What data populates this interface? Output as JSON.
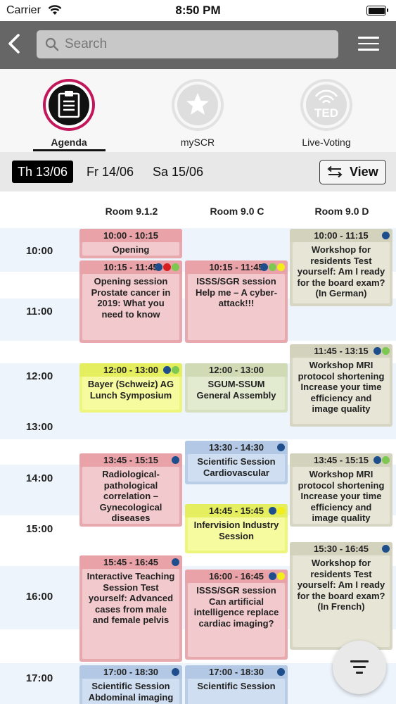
{
  "status_bar": {
    "carrier": "Carrier",
    "time": "8:50 PM"
  },
  "nav": {
    "search_placeholder": "Search"
  },
  "tabs": [
    {
      "label": "Agenda",
      "icon": "clipboard-icon",
      "active": true
    },
    {
      "label": "mySCR",
      "icon": "star-icon",
      "active": false
    },
    {
      "label": "Live-Voting",
      "icon": "ted-icon",
      "active": false
    }
  ],
  "dates": [
    {
      "label": "Th 13/06",
      "active": true
    },
    {
      "label": "Fr 14/06",
      "active": false
    },
    {
      "label": "Sa 15/06",
      "active": false
    }
  ],
  "view_button": {
    "label": "View"
  },
  "rooms": [
    "Room 9.1.2",
    "Room 9.0 C",
    "Room 9.0 D"
  ],
  "times": [
    "10:00",
    "11:00",
    "12:00",
    "13:00",
    "14:00",
    "15:00",
    "16:00",
    "17:00"
  ],
  "dot_colors": {
    "blue": "#1f4e8c",
    "red": "#d81e1e",
    "green": "#7ec852",
    "yellow": "#f3ee1a"
  },
  "events": [
    {
      "room": "Room 9.1.2",
      "time": "10:00 - 10:15",
      "title": "Opening",
      "color": "red",
      "dots": []
    },
    {
      "room": "Room 9.1.2",
      "time": "10:15 - 11:45",
      "title": "Opening session Prostate cancer in 2019: What you need to know",
      "color": "red",
      "dots": [
        "blue",
        "red",
        "green"
      ]
    },
    {
      "room": "Room 9.1.2",
      "time": "12:00 - 13:00",
      "title": "Bayer (Schweiz) AG Lunch Symposium",
      "color": "yellow",
      "dots": [
        "blue",
        "green"
      ]
    },
    {
      "room": "Room 9.1.2",
      "time": "13:45 - 15:15",
      "title": "Radiological-pathological correlation – Gynecological diseases",
      "color": "red",
      "dots": [
        "blue"
      ]
    },
    {
      "room": "Room 9.1.2",
      "time": "15:45 - 16:45",
      "title": "Interactive Teaching Session Test yourself: Advanced cases from male and female pelvis",
      "color": "red",
      "dots": [
        "blue"
      ]
    },
    {
      "room": "Room 9.1.2",
      "time": "17:00 - 18:30",
      "title": "Scientific Session Abdominal imaging",
      "color": "blue",
      "dots": [
        "blue"
      ]
    },
    {
      "room": "Room 9.0 C",
      "time": "10:15 - 11:45",
      "title": "ISSS/SGR session Help me – A cyber-attack!!!",
      "color": "red",
      "dots": [
        "blue",
        "green",
        "yellow"
      ]
    },
    {
      "room": "Room 9.0 C",
      "time": "12:00 - 13:00",
      "title": "SGUM-SSUM General Assembly",
      "color": "green",
      "dots": []
    },
    {
      "room": "Room 9.0 C",
      "time": "13:30 - 14:30",
      "title": "Scientific Session Cardiovascular",
      "color": "blue",
      "dots": [
        "blue"
      ]
    },
    {
      "room": "Room 9.0 C",
      "time": "14:45 - 15:45",
      "title": "Infervision Industry Session",
      "color": "yellow",
      "dots": [
        "blue",
        "yellow"
      ]
    },
    {
      "room": "Room 9.0 C",
      "time": "16:00 - 16:45",
      "title": "ISSS/SGR session Can artificial intelligence replace cardiac imaging?",
      "color": "red",
      "dots": [
        "blue",
        "yellow"
      ]
    },
    {
      "room": "Room 9.0 C",
      "time": "17:00 - 18:30",
      "title": "Scientific Session",
      "color": "blue",
      "dots": [
        "blue"
      ]
    },
    {
      "room": "Room 9.0 D",
      "time": "10:00 - 11:15",
      "title": "Workshop for residents Test yourself: Am I ready for the board exam? (In German)",
      "color": "beige",
      "dots": [
        "blue"
      ]
    },
    {
      "room": "Room 9.0 D",
      "time": "11:45 - 13:15",
      "title": "Workshop MRI protocol shortening Increase your time efficiency and image quality",
      "color": "beige",
      "dots": [
        "blue",
        "green"
      ]
    },
    {
      "room": "Room 9.0 D",
      "time": "13:45 - 15:15",
      "title": "Workshop MRI protocol shortening Increase your time efficiency and image quality",
      "color": "beige",
      "dots": [
        "blue",
        "green"
      ]
    },
    {
      "room": "Room 9.0 D",
      "time": "15:30 - 16:45",
      "title": "Workshop for residents Test yourself: Am I ready for the board exam? (In French)",
      "color": "beige",
      "dots": [
        "blue"
      ]
    }
  ]
}
